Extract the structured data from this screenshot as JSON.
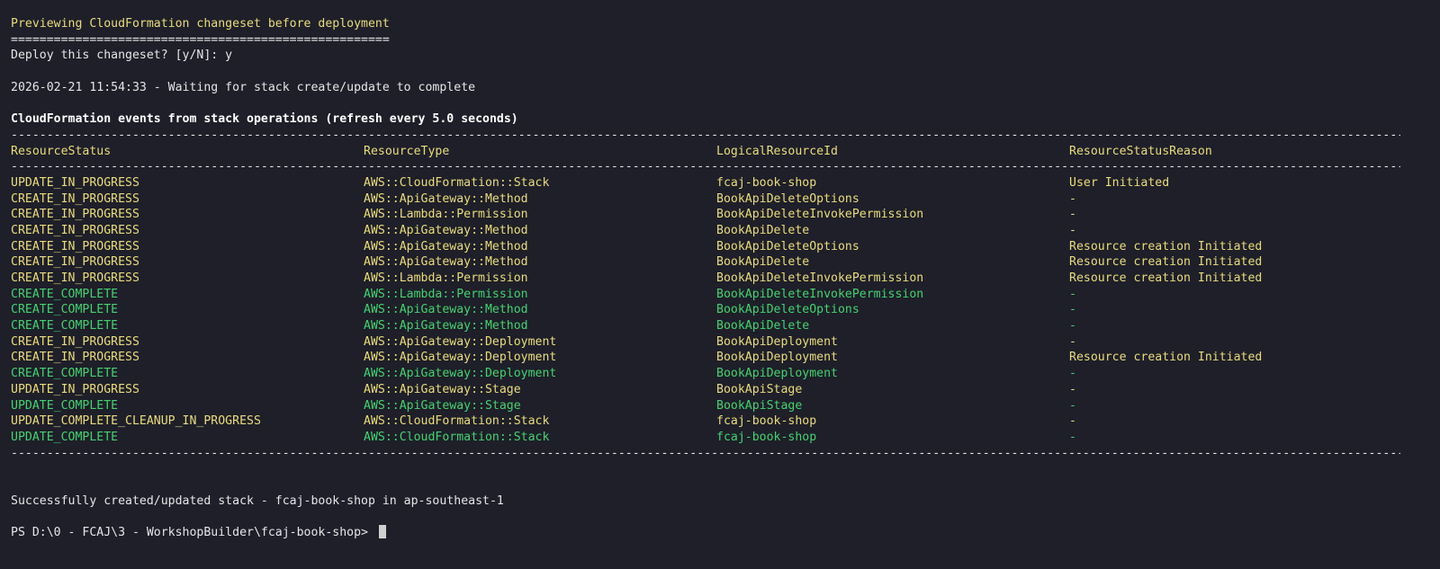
{
  "header": {
    "preview_title": "Previewing CloudFormation changeset before deployment",
    "preview_rule": "=====================================================",
    "prompt": "Deploy this changeset? [y/N]: y",
    "waiting": "2026-02-21 11:54:33 - Waiting for stack create/update to complete",
    "events_title": "CloudFormation events from stack operations (refresh every 5.0 seconds)"
  },
  "rule": "-------------------------------------------------------------------------------------------------------------------------------------------------------------------------------------------------------------------",
  "table": {
    "headers": [
      "ResourceStatus",
      "ResourceType",
      "LogicalResourceId",
      "ResourceStatusReason"
    ],
    "rows": [
      {
        "status": "UPDATE_IN_PROGRESS",
        "type": "AWS::CloudFormation::Stack",
        "id": "fcaj-book-shop",
        "reason": "User Initiated",
        "color": "yellow"
      },
      {
        "status": "CREATE_IN_PROGRESS",
        "type": "AWS::ApiGateway::Method",
        "id": "BookApiDeleteOptions",
        "reason": "-",
        "color": "yellow"
      },
      {
        "status": "CREATE_IN_PROGRESS",
        "type": "AWS::Lambda::Permission",
        "id": "BookApiDeleteInvokePermission",
        "reason": "-",
        "color": "yellow"
      },
      {
        "status": "CREATE_IN_PROGRESS",
        "type": "AWS::ApiGateway::Method",
        "id": "BookApiDelete",
        "reason": "-",
        "color": "yellow"
      },
      {
        "status": "CREATE_IN_PROGRESS",
        "type": "AWS::ApiGateway::Method",
        "id": "BookApiDeleteOptions",
        "reason": "Resource creation Initiated",
        "color": "yellow"
      },
      {
        "status": "CREATE_IN_PROGRESS",
        "type": "AWS::ApiGateway::Method",
        "id": "BookApiDelete",
        "reason": "Resource creation Initiated",
        "color": "yellow"
      },
      {
        "status": "CREATE_IN_PROGRESS",
        "type": "AWS::Lambda::Permission",
        "id": "BookApiDeleteInvokePermission",
        "reason": "Resource creation Initiated",
        "color": "yellow"
      },
      {
        "status": "CREATE_COMPLETE",
        "type": "AWS::Lambda::Permission",
        "id": "BookApiDeleteInvokePermission",
        "reason": "-",
        "color": "green"
      },
      {
        "status": "CREATE_COMPLETE",
        "type": "AWS::ApiGateway::Method",
        "id": "BookApiDeleteOptions",
        "reason": "-",
        "color": "green"
      },
      {
        "status": "CREATE_COMPLETE",
        "type": "AWS::ApiGateway::Method",
        "id": "BookApiDelete",
        "reason": "-",
        "color": "green"
      },
      {
        "status": "CREATE_IN_PROGRESS",
        "type": "AWS::ApiGateway::Deployment",
        "id": "BookApiDeployment",
        "reason": "-",
        "color": "yellow"
      },
      {
        "status": "CREATE_IN_PROGRESS",
        "type": "AWS::ApiGateway::Deployment",
        "id": "BookApiDeployment",
        "reason": "Resource creation Initiated",
        "color": "yellow"
      },
      {
        "status": "CREATE_COMPLETE",
        "type": "AWS::ApiGateway::Deployment",
        "id": "BookApiDeployment",
        "reason": "-",
        "color": "green"
      },
      {
        "status": "UPDATE_IN_PROGRESS",
        "type": "AWS::ApiGateway::Stage",
        "id": "BookApiStage",
        "reason": "-",
        "color": "yellow"
      },
      {
        "status": "UPDATE_COMPLETE",
        "type": "AWS::ApiGateway::Stage",
        "id": "BookApiStage",
        "reason": "-",
        "color": "green"
      },
      {
        "status": "UPDATE_COMPLETE_CLEANUP_IN_PROGRESS",
        "type": "AWS::CloudFormation::Stack",
        "id": "fcaj-book-shop",
        "reason": "-",
        "color": "yellow"
      },
      {
        "status": "UPDATE_COMPLETE",
        "type": "AWS::CloudFormation::Stack",
        "id": "fcaj-book-shop",
        "reason": "-",
        "color": "green"
      }
    ]
  },
  "footer": {
    "success": "Successfully created/updated stack - fcaj-book-shop in ap-southeast-1",
    "prompt": "PS D:\\0 - FCAJ\\3 - WorkshopBuilder\\fcaj-book-shop> "
  },
  "colors": {
    "background": "#1e1f29",
    "yellow": "#eadc7a",
    "green": "#43d36f",
    "text": "#e6e6e6"
  }
}
